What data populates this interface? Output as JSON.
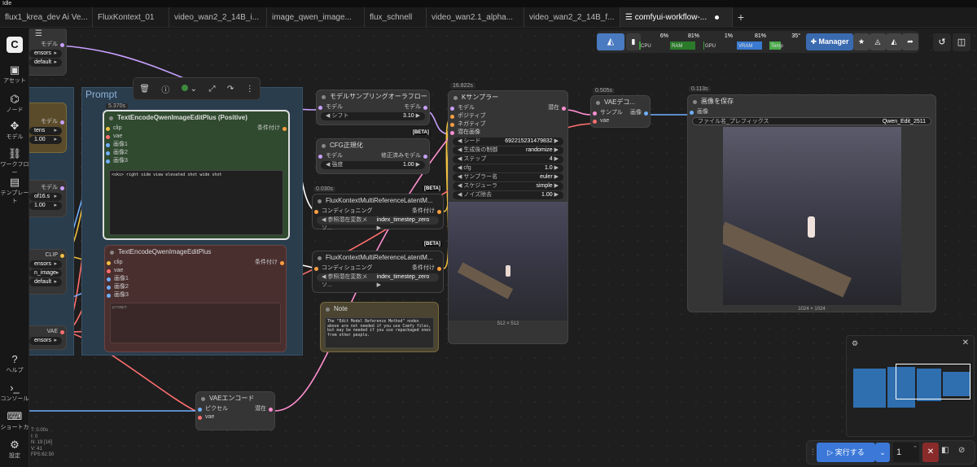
{
  "window": {
    "title": "Idle"
  },
  "tabs": [
    {
      "label": "flux1_krea_dev Ai Ve..."
    },
    {
      "label": "FluxKontext_01"
    },
    {
      "label": "video_wan2_2_14B_i..."
    },
    {
      "label": "image_qwen_image..."
    },
    {
      "label": "flux_schnell"
    },
    {
      "label": "video_wan2.1_alpha..."
    },
    {
      "label": "video_wan2_2_14B_f..."
    },
    {
      "label": "comfyui-workflow-..."
    }
  ],
  "new_tab_label": "+",
  "sidebar": {
    "logo": "C",
    "items": [
      {
        "label": "アセット",
        "icon": "image-icon"
      },
      {
        "label": "ノード",
        "icon": "node-icon"
      },
      {
        "label": "モデル",
        "icon": "cube-icon"
      },
      {
        "label": "ワークフロー",
        "icon": "workflow-icon"
      },
      {
        "label": "テンプレート",
        "icon": "template-icon"
      }
    ],
    "bottom_items": [
      {
        "label": "ヘルプ",
        "icon": "help-icon"
      },
      {
        "label": "コンソール",
        "icon": "console-icon"
      },
      {
        "label": "ショートカ",
        "icon": "keyboard-icon"
      },
      {
        "label": "設定",
        "icon": "settings-icon"
      }
    ]
  },
  "stats": [
    "T: 0.00s",
    "I: 0",
    "N: 19 [16]",
    "V: 41",
    "FPS:62.50"
  ],
  "resources": {
    "cpu": {
      "label": "CPU",
      "pct": "6%",
      "value": 0.06
    },
    "ram": {
      "label": "RAM",
      "pct": "81%",
      "value": 0.81
    },
    "gpu": {
      "label": "GPU",
      "pct": "1%",
      "value": 0.01
    },
    "vram": {
      "label": "VRAM",
      "pct": "81%",
      "value": 0.81
    },
    "temp": {
      "label": "Temp",
      "pct": "35°",
      "value": 0.35
    },
    "manager_label": "Manager"
  },
  "group": {
    "title": "Prompt"
  },
  "nodes": {
    "partial_top": {
      "model_label": "モデル",
      "w1": "ensors",
      "w2": "default"
    },
    "partial_mid": {
      "model_label": "モデル",
      "w1": "tens",
      "w2": "1.00"
    },
    "partial_lora": {
      "model_label": "モデル",
      "w1": "of16.s",
      "w2": "1.00"
    },
    "partial_clip": {
      "clip_label": "CLIP",
      "w1": "ensors",
      "w2": "n_image",
      "w3": "default"
    },
    "partial_vae": {
      "vae_label": "VAE",
      "w1": "ensors"
    },
    "pos": {
      "time": "5.370s",
      "title": "TextEncodeQwenImageEditPlus (Positive)",
      "inputs": [
        "clip",
        "vae",
        "画像1",
        "画像2",
        "画像3"
      ],
      "output": "条件付け",
      "text": "<sks> right side view elevated shot wide shot"
    },
    "neg": {
      "title": "TextEncodeQwenImageEditPlus",
      "inputs": [
        "clip",
        "vae",
        "画像1",
        "画像2",
        "画像3"
      ],
      "output": "条件付け",
      "placeholder": "prompt"
    },
    "sampling": {
      "title": "モデルサンプリングオーラフロー",
      "in": "モデル",
      "out": "モデル",
      "widget_label": "シフト",
      "widget_value": "3.10"
    },
    "cfgnorm": {
      "title": "CFG正規化",
      "in": "モデル",
      "out": "修正済みモデル",
      "widget_label": "強度",
      "widget_value": "1.00",
      "beta": "[BETA]"
    },
    "kontext1": {
      "time": "0.030s",
      "title": "FluxKontextMultiReferenceLatentM...",
      "in": "コンディショニング",
      "out": "条件付け",
      "widget_label": "参照潜在変数メソ...",
      "widget_value": "index_timestep_zero",
      "beta": "[BETA]"
    },
    "kontext2": {
      "title": "FluxKontextMultiReferenceLatentM...",
      "in": "コンディショニング",
      "out": "条件付け",
      "widget_label": "参照潜在変数メソ...",
      "widget_value": "index_timestep_zero",
      "beta": "[BETA]"
    },
    "ksampler": {
      "time": "16.822s",
      "title": "Kサンプラー",
      "inputs": [
        "モデル",
        "ポジティブ",
        "ネガティブ",
        "潜在画像"
      ],
      "output": "潜在",
      "widgets": [
        {
          "label": "シード",
          "value": "692215231479832"
        },
        {
          "label": "生成後の制御",
          "value": "randomize"
        },
        {
          "label": "ステップ",
          "value": "4"
        },
        {
          "label": "cfg",
          "value": "1.0"
        },
        {
          "label": "サンプラー名",
          "value": "euler"
        },
        {
          "label": "スケジューラ",
          "value": "simple"
        },
        {
          "label": "ノイズ除去",
          "value": "1.00"
        }
      ],
      "preview_size": "512 × 512"
    },
    "vaedecode": {
      "time": "0.505s",
      "title": "VAEデコ...",
      "inputs": [
        "サンプル",
        "vae"
      ],
      "output": "画像"
    },
    "save": {
      "time": "0.113s",
      "title": "画像を保存",
      "input": "画像",
      "widget_label": "ファイル名_プレフィックス",
      "widget_value": "Qwen_Edit_2511",
      "image_size": "1024 × 1024"
    },
    "note": {
      "title": "Note",
      "text": "The \"Edit Model Reference Method\" nodes above are not needed if you use Comfy files, but may be needed if you use repackaged ones from other people."
    },
    "vaeencode": {
      "title": "VAEエンコード",
      "in1": "ピクセル",
      "in2": "vae",
      "out": "潜在"
    }
  },
  "runbar": {
    "run_label": "実行する",
    "count": "1"
  }
}
